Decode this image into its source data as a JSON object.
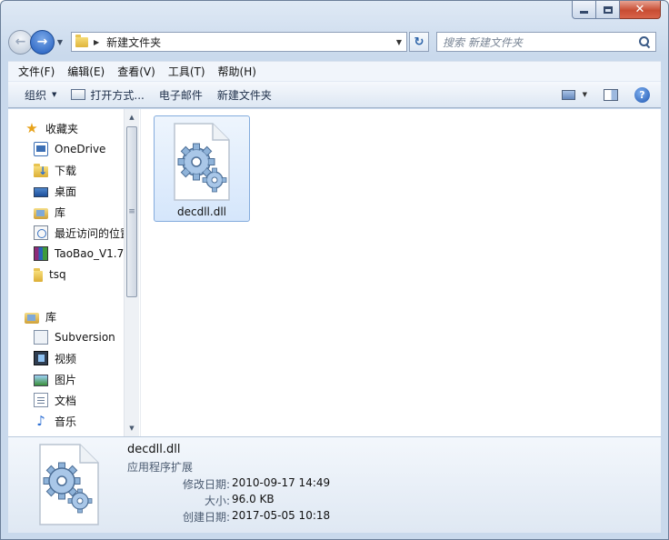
{
  "window": {
    "address": {
      "crumb": "新建文件夹"
    },
    "search": {
      "placeholder": "搜索 新建文件夹"
    }
  },
  "menubar": {
    "items": [
      "文件(F)",
      "编辑(E)",
      "查看(V)",
      "工具(T)",
      "帮助(H)"
    ]
  },
  "toolbar": {
    "organize": "组织",
    "open_with": "打开方式...",
    "email": "电子邮件",
    "new_folder": "新建文件夹"
  },
  "nav": {
    "favorites": "收藏夹",
    "favorites_items": [
      "OneDrive",
      "下载",
      "桌面",
      "库",
      "最近访问的位置",
      "TaoBao_V1.7",
      "tsq"
    ],
    "libraries": "库",
    "library_items": [
      "Subversion",
      "视频",
      "图片",
      "文档",
      "音乐"
    ]
  },
  "files": [
    {
      "name": "decdll.dll"
    }
  ],
  "details": {
    "name": "decdll.dll",
    "type": "应用程序扩展",
    "modified_label": "修改日期:",
    "modified_value": "2010-09-17 14:49",
    "size_label": "大小:",
    "size_value": "96.0 KB",
    "created_label": "创建日期:",
    "created_value": "2017-05-05 10:18"
  },
  "colors": {
    "chrome": "#c9d9ec",
    "selection": "#d5e6fb",
    "close_button": "#c84c32"
  }
}
